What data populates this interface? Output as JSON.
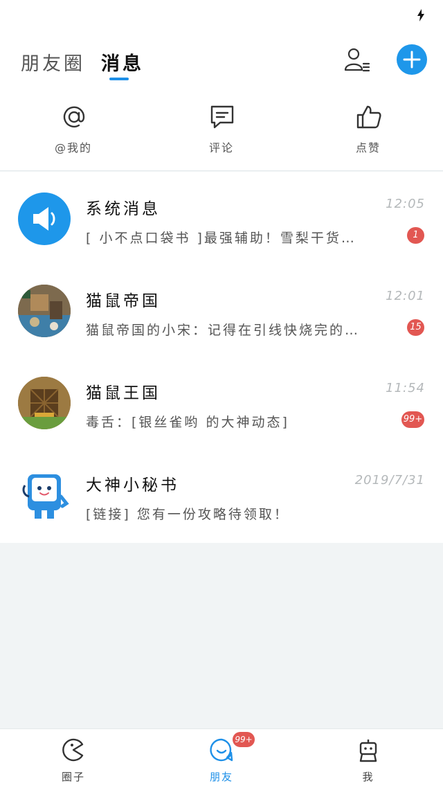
{
  "header": {
    "tabs": [
      {
        "label": "朋友圈",
        "active": false
      },
      {
        "label": "消息",
        "active": true
      }
    ]
  },
  "quick_actions": [
    {
      "label": "@我的",
      "icon": "at-icon"
    },
    {
      "label": "评论",
      "icon": "comment-icon"
    },
    {
      "label": "点赞",
      "icon": "thumbs-up-icon"
    }
  ],
  "conversations": [
    {
      "title": "系统消息",
      "time": "12:05",
      "preview": "[ 小不点口袋书 ]最强辅助！雪梨干货…",
      "badge": "1",
      "avatar": "speaker-icon"
    },
    {
      "title": "猫鼠帝国",
      "time": "12:01",
      "preview": "猫鼠帝国的小宋：记得在引线快烧完的…",
      "badge": "15",
      "avatar": "group-avatar"
    },
    {
      "title": "猫鼠王国",
      "time": "11:54",
      "preview": "毒舌：[银丝雀哟 的大神动态]",
      "badge": "99+",
      "avatar": "group-avatar"
    },
    {
      "title": "大神小秘书",
      "time": "2019/7/31",
      "preview": "[链接] 您有一份攻略待领取！",
      "badge": "",
      "avatar": "robot-mascot"
    }
  ],
  "bottom_nav": [
    {
      "label": "圈子",
      "icon": "pacman-icon",
      "active": false
    },
    {
      "label": "朋友",
      "icon": "smile-bubble-icon",
      "active": true,
      "badge": "99+"
    },
    {
      "label": "我",
      "icon": "robot-icon",
      "active": false
    }
  ],
  "colors": {
    "accent": "#1e90e8",
    "badge": "#e25752",
    "background": "#f1f4f5"
  }
}
